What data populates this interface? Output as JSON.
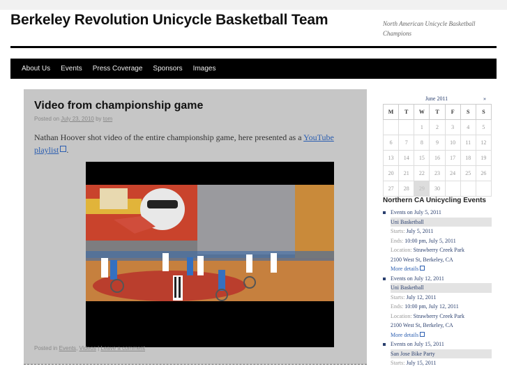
{
  "site": {
    "title": "Berkeley Revolution Unicycle Basketball Team",
    "tagline": "North American Unicycle Basketball Champions"
  },
  "nav": [
    "About Us",
    "Events",
    "Press Coverage",
    "Sponsors",
    "Images"
  ],
  "post": {
    "title": "Video from championship game",
    "posted_on_prefix": "Posted on",
    "date": "July 23, 2010",
    "by": "by",
    "author": "tom",
    "body_text": "Nathan Hoover shot video of the entire championship game, here presented as a",
    "link_text": "YouTube playlist",
    "body_end": ".",
    "footer_prefix": "Posted in",
    "categories": [
      "Events",
      "Videos"
    ],
    "sep1": ",",
    "sep2": "|",
    "comment_link": "Leave a comment"
  },
  "calendar": {
    "caption": "June 2011",
    "next": "»",
    "weekdays": [
      "M",
      "T",
      "W",
      "T",
      "F",
      "S",
      "S"
    ],
    "weeks": [
      [
        "",
        "",
        "1",
        "2",
        "3",
        "4",
        "5"
      ],
      [
        "6",
        "7",
        "8",
        "9",
        "10",
        "11",
        "12"
      ],
      [
        "13",
        "14",
        "15",
        "16",
        "17",
        "18",
        "19"
      ],
      [
        "20",
        "21",
        "22",
        "23",
        "24",
        "25",
        "26"
      ],
      [
        "27",
        "28",
        "29",
        "30",
        "",
        "",
        ""
      ]
    ],
    "today": "29"
  },
  "events_widget": {
    "heading": "Northern CA Unicycling Events",
    "starts_label": "Starts:",
    "ends_label": "Ends:",
    "location_label": "Location:",
    "more": "More details",
    "events": [
      {
        "date_line": "Events on July 5, 2011",
        "title": "Uni Basketball",
        "starts": "July 5, 2011",
        "ends": "10:00 pm, July 5, 2011",
        "location1": "Strawberry Creek Park",
        "location2": "2100 West St, Berkeley, CA"
      },
      {
        "date_line": "Events on July 12, 2011",
        "title": "Uni Basketball",
        "starts": "July 12, 2011",
        "ends": "10:00 pm, July 12, 2011",
        "location1": "Strawberry Creek Park",
        "location2": "2100 West St, Berkeley, CA"
      },
      {
        "date_line": "Events on July 15, 2011",
        "title": "San Jose Bike Party",
        "starts": "July 15, 2011"
      }
    ]
  }
}
